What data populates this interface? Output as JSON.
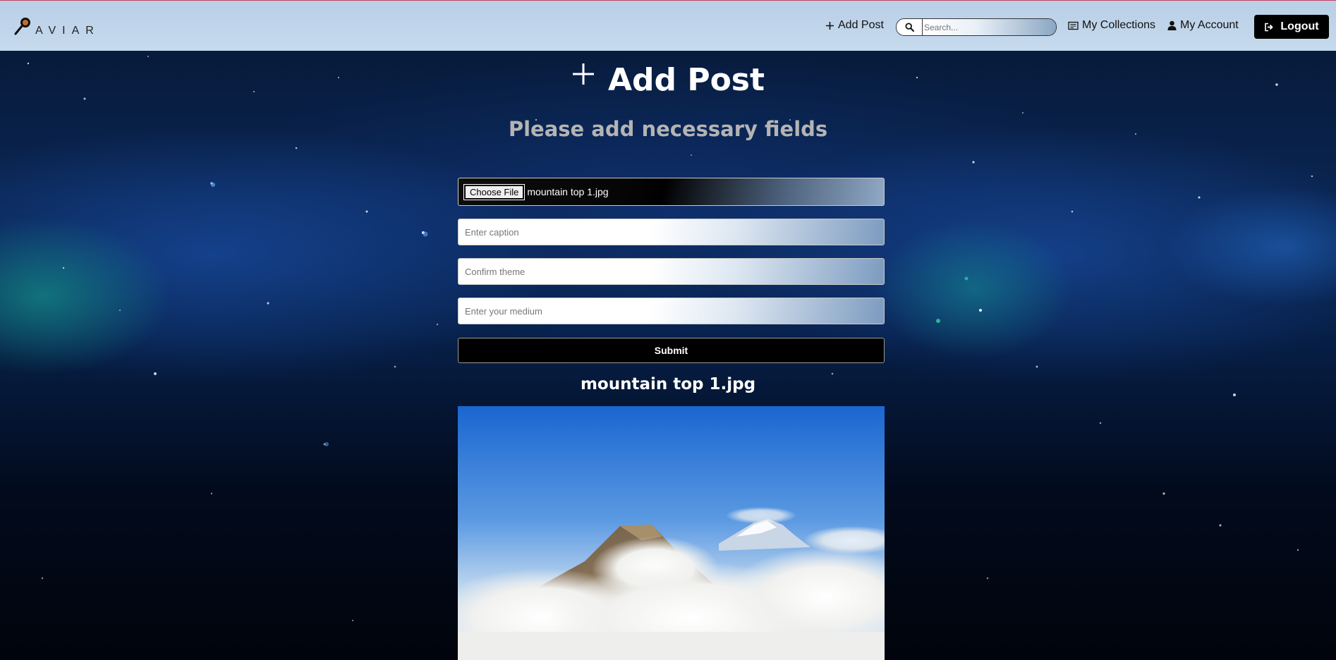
{
  "app": {
    "brand": "AVIAR"
  },
  "navbar": {
    "add_post_label": "Add Post",
    "search_placeholder": "Search...",
    "my_collections_label": "My Collections",
    "my_account_label": "My Account",
    "logout_label": "Logout"
  },
  "page": {
    "title": "Add Post",
    "subtitle": "Please add necessary fields"
  },
  "form": {
    "choose_file_label": "Choose File",
    "selected_file": "mountain top 1.jpg",
    "caption_placeholder": "Enter caption",
    "theme_placeholder": "Confirm theme",
    "medium_placeholder": "Enter your medium",
    "submit_label": "Submit"
  },
  "preview": {
    "file_name": "mountain top 1.jpg"
  },
  "colors": {
    "navbar_bg": "#c0d5eb",
    "button_black": "#000000",
    "title_white": "#ffffff",
    "subtitle_gray": "#b4b4b4"
  }
}
